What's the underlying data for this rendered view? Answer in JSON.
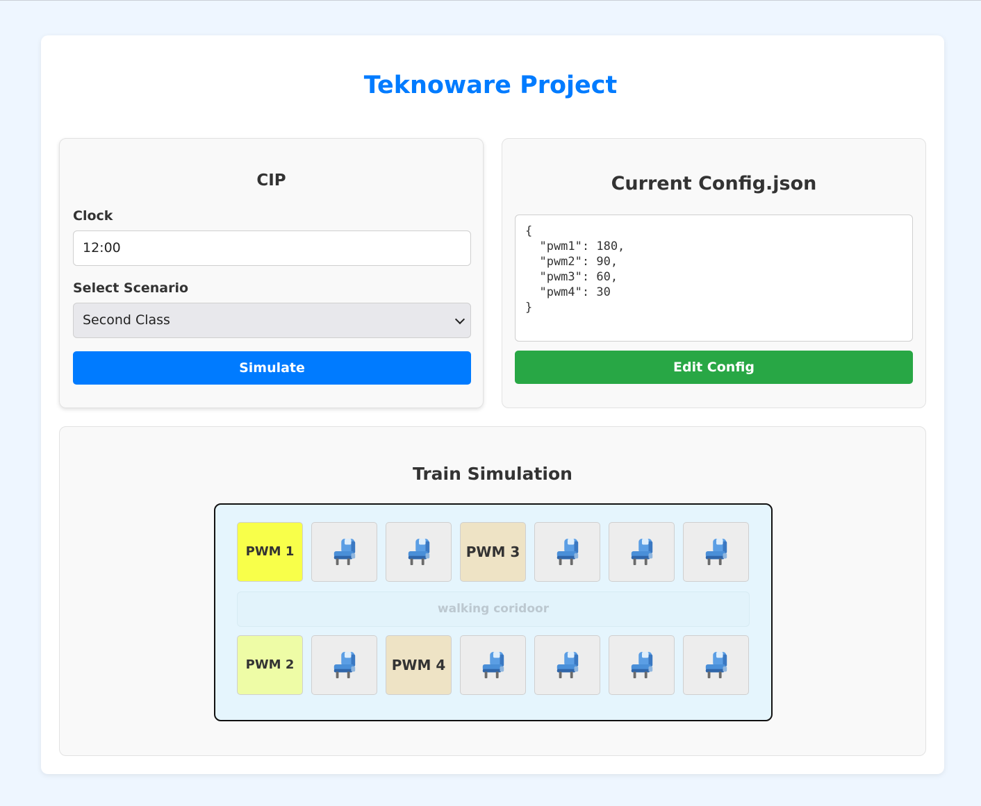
{
  "title": "Teknoware Project",
  "cip": {
    "title": "CIP",
    "clock_label": "Clock",
    "clock_value": "12:00",
    "scenario_label": "Select Scenario",
    "scenario_value": "Second Class",
    "simulate_label": "Simulate"
  },
  "config": {
    "title": "Current Config.json",
    "json_text": "{\n  \"pwm1\": 180,\n  \"pwm2\": 90,\n  \"pwm3\": 60,\n  \"pwm4\": 30\n}",
    "edit_label": "Edit Config"
  },
  "train": {
    "title": "Train Simulation",
    "corridor_label": "walking coridoor",
    "pwm1": "PWM 1",
    "pwm2": "PWM 2",
    "pwm3": "PWM 3",
    "pwm4": "PWM 4"
  },
  "colors": {
    "accent": "#007bff",
    "edit_button": "#28a745",
    "pwm1_bg": "#f8ff4a",
    "pwm2_bg": "#eefca6",
    "pwm3_bg": "#eee3c5",
    "pwm4_bg": "#eee3c5",
    "seat_icon": "#4a8fd8"
  },
  "icons": {
    "seat": "seat-icon",
    "dropdown": "chevron-down-icon"
  }
}
